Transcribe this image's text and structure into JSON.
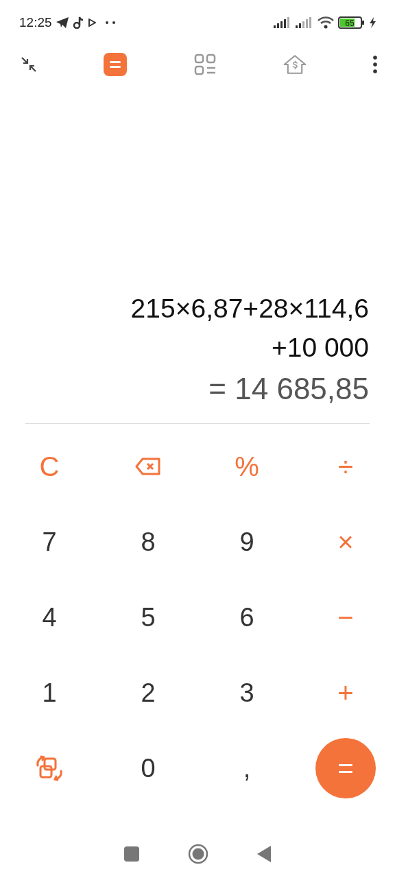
{
  "status_bar": {
    "time": "12:25",
    "battery": "65"
  },
  "toolbar": {
    "tabs": [
      {
        "kind": "calculator",
        "selected": true
      },
      {
        "kind": "converter",
        "selected": false
      },
      {
        "kind": "finance",
        "selected": false
      }
    ]
  },
  "display": {
    "expression_lines": [
      "215×6,87+28×114,6",
      "+10 000"
    ],
    "result": "= 14 685,85"
  },
  "keys": [
    {
      "kind": "function",
      "label": "C"
    },
    {
      "kind": "backspace"
    },
    {
      "kind": "function",
      "label": "%"
    },
    {
      "kind": "function",
      "label": "÷"
    },
    {
      "kind": "digit",
      "label": "7"
    },
    {
      "kind": "digit",
      "label": "8"
    },
    {
      "kind": "digit",
      "label": "9"
    },
    {
      "kind": "function",
      "label": "×"
    },
    {
      "kind": "digit",
      "label": "4"
    },
    {
      "kind": "digit",
      "label": "5"
    },
    {
      "kind": "digit",
      "label": "6"
    },
    {
      "kind": "function",
      "label": "−"
    },
    {
      "kind": "digit",
      "label": "1"
    },
    {
      "kind": "digit",
      "label": "2"
    },
    {
      "kind": "digit",
      "label": "3"
    },
    {
      "kind": "function",
      "label": "+"
    },
    {
      "kind": "convert"
    },
    {
      "kind": "digit",
      "label": "0"
    },
    {
      "kind": "digit",
      "label": ","
    },
    {
      "kind": "equals",
      "label": "="
    }
  ]
}
